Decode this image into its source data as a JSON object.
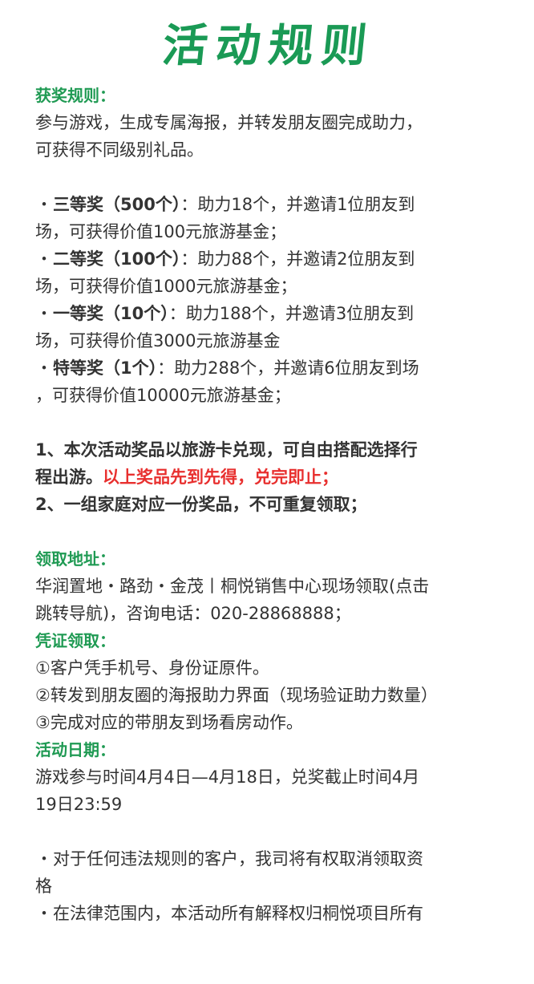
{
  "title": "活动规则",
  "sections": {
    "award_rules_heading": "获奖规则：",
    "award_rules_text_1": "参与游戏，生成专属海报，并转发朋友圈完成助力，",
    "award_rules_text_2": "可获得不同级别礼品。",
    "prizes": [
      {
        "name": "三等奖（500个）",
        "desc_1": "：助力18个，并邀请1位朋友到",
        "desc_2": "场，可获得价值100元旅游基金；"
      },
      {
        "name": "二等奖（100个）",
        "desc_1": "：助力88个，并邀请2位朋友到",
        "desc_2": "场，可获得价值1000元旅游基金；"
      },
      {
        "name": "一等奖（10个）",
        "desc_1": "：助力188个，并邀请3位朋友到",
        "desc_2": "场，可获得价值3000元旅游基金"
      },
      {
        "name": "特等奖（1个）",
        "desc_1": "：助力288个，并邀请6位朋友到场",
        "desc_2": "，可获得价值10000元旅游基金；"
      }
    ],
    "note_1_line_1": "1、本次活动奖品以旅游卡兑现，可自由搭配选择行",
    "note_1_line_2": "程出游。",
    "note_1_red": "以上奖品先到先得，兑完即止；",
    "note_2": "2、一组家庭对应一份奖品，不可重复领取；",
    "address_heading": "领取地址：",
    "address_line_1": "华润置地・路劲・金茂丨桐悦销售中心现场领取(点击",
    "address_line_2": "跳转导航)，咨询电话：020-28868888；",
    "proof_heading": "凭证领取：",
    "proof_items": [
      "①客户凭手机号、身份证原件。",
      "②转发到朋友圈的海报助力界面（现场验证助力数量）",
      "③完成对应的带朋友到场看房动作。"
    ],
    "date_heading": "活动日期：",
    "date_line_1": "游戏参与时间4月4日—4月18日，兑奖截止时间4月",
    "date_line_2": "19日23:59",
    "terms_1_line_1": "对于任何违法规则的客户，我司将有权取消领取资",
    "terms_1_line_2": "格",
    "terms_2": "在法律范围内，本活动所有解释权归桐悦项目所有"
  },
  "bullet": "・"
}
